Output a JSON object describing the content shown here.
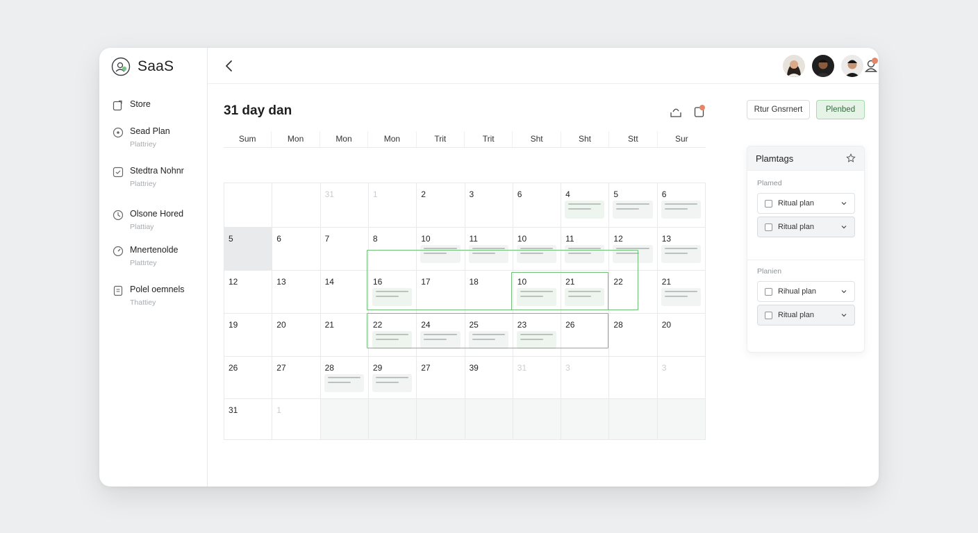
{
  "brand": {
    "name": "SaaS"
  },
  "sidebar": {
    "items": [
      {
        "label": "Store",
        "sub": "",
        "icon": "edit-icon"
      },
      {
        "label": "Sead Plan",
        "sub": "Plattriey",
        "icon": "target-icon"
      },
      {
        "label": "Stedtra Nohnr",
        "sub": "Plattriey",
        "icon": "chat-icon"
      },
      {
        "label": "Olsone Hored",
        "sub": "Plattiay",
        "icon": "clock-icon"
      },
      {
        "label": "Mnertenolde",
        "sub": "Plattrtey",
        "icon": "gauge-icon"
      },
      {
        "label": "Polel oemnels",
        "sub": "Thattiey",
        "icon": "document-icon"
      }
    ]
  },
  "page": {
    "title": "31 day dan"
  },
  "calendar": {
    "headers": [
      "Sum",
      "Mon",
      "Mon",
      "Mon",
      "Trit",
      "Trit",
      "Sht",
      "Sht",
      "Stt",
      "Sur"
    ],
    "rows": [
      [
        {
          "n": ""
        },
        {
          "n": ""
        },
        {
          "n": "31",
          "dim": true
        },
        {
          "n": "1",
          "dim": true
        },
        {
          "n": "2"
        },
        {
          "n": "3"
        },
        {
          "n": "6"
        },
        {
          "n": "4",
          "ev": "green"
        },
        {
          "n": "5",
          "ev": "neutral"
        },
        {
          "n": "6",
          "ev": "neutral"
        }
      ],
      [
        {
          "n": "5",
          "shaded": true
        },
        {
          "n": "6"
        },
        {
          "n": "7"
        },
        {
          "n": "8"
        },
        {
          "n": "10",
          "ev": "neutral"
        },
        {
          "n": "11",
          "ev": "neutral"
        },
        {
          "n": "10",
          "ev": "neutral"
        },
        {
          "n": "11",
          "ev": "neutral"
        },
        {
          "n": "12",
          "ev": "neutral"
        },
        {
          "n": "13",
          "ev": "neutral"
        }
      ],
      [
        {
          "n": "12"
        },
        {
          "n": "13"
        },
        {
          "n": "14"
        },
        {
          "n": "16",
          "ev": "green"
        },
        {
          "n": "17"
        },
        {
          "n": "18"
        },
        {
          "n": "10",
          "ev": "green"
        },
        {
          "n": "21",
          "ev": "green"
        },
        {
          "n": "22"
        },
        {
          "n": "21",
          "ev": "neutral"
        }
      ],
      [
        {
          "n": "19"
        },
        {
          "n": "20"
        },
        {
          "n": "21"
        },
        {
          "n": "22",
          "ev": "green"
        },
        {
          "n": "24",
          "ev": "neutral"
        },
        {
          "n": "25",
          "ev": "neutral"
        },
        {
          "n": "23",
          "ev": "green"
        },
        {
          "n": "26"
        },
        {
          "n": "28"
        },
        {
          "n": "20"
        }
      ],
      [
        {
          "n": "26"
        },
        {
          "n": "27"
        },
        {
          "n": "28",
          "ev": "neutral"
        },
        {
          "n": "29",
          "ev": "neutral"
        },
        {
          "n": "27"
        },
        {
          "n": "39"
        },
        {
          "n": "31",
          "dim": true
        },
        {
          "n": "3",
          "dim": true
        },
        {
          "n": ""
        },
        {
          "n": "3",
          "dim": true
        }
      ],
      [
        {
          "n": "31"
        },
        {
          "n": "1",
          "dim": true
        },
        {
          "n": "",
          "grey": true
        },
        {
          "n": "",
          "grey": true
        },
        {
          "n": "",
          "grey": true
        },
        {
          "n": "",
          "grey": true
        },
        {
          "n": "",
          "grey": true
        },
        {
          "n": "",
          "grey": true
        },
        {
          "n": "",
          "grey": true
        },
        {
          "n": "",
          "grey": true
        }
      ]
    ]
  },
  "actions": {
    "outline_label": "Rtur Gnsrnert",
    "primary_label": "Plenbed"
  },
  "panel": {
    "title": "Plamtags",
    "sections": [
      {
        "label": "Plamed",
        "items": [
          "Ritual plan",
          "Ritual plan"
        ]
      },
      {
        "label": "Planien",
        "items": [
          "Rihual plan",
          "Ritual plan"
        ]
      }
    ]
  },
  "colors": {
    "accent_green": "#6fbf79",
    "notification": "#e4866a"
  }
}
